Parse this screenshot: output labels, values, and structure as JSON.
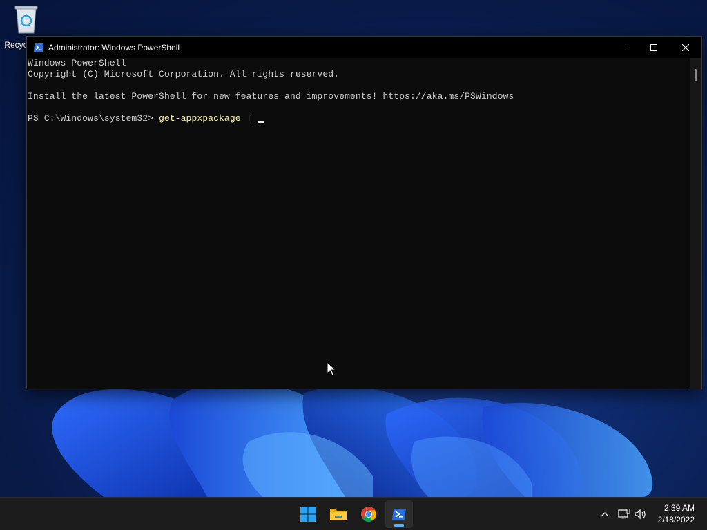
{
  "desktop": {
    "recycle_bin_label": "Recycle Bin"
  },
  "window": {
    "title": "Administrator: Windows PowerShell",
    "minimize_icon": "minimize-icon",
    "maximize_icon": "maximize-icon",
    "close_icon": "close-icon"
  },
  "console": {
    "lines": [
      "Windows PowerShell",
      "Copyright (C) Microsoft Corporation. All rights reserved.",
      "",
      "Install the latest PowerShell for new features and improvements! https://aka.ms/PSWindows",
      ""
    ],
    "prompt": "PS C:\\Windows\\system32> ",
    "command": "get-appxpackage",
    "after_command": " | "
  },
  "taskbar": {
    "apps": [
      "start-icon",
      "file-explorer-icon",
      "chrome-icon",
      "powershell-icon"
    ],
    "active_app": "powershell-icon",
    "tray": [
      "show-hidden-icons-chevron",
      "network-icon",
      "volume-icon"
    ],
    "time": "2:39 AM",
    "date": "2/18/2022"
  },
  "colors": {
    "console_bg": "#0c0c0c",
    "console_text": "#cccccc",
    "command_text": "#f9f1a5",
    "taskbar_bg": "#1c1c1c",
    "active_indicator": "#5fb2f2"
  }
}
